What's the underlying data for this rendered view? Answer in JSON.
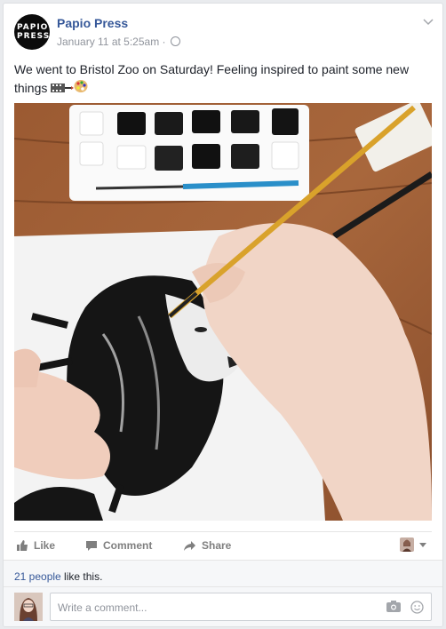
{
  "post": {
    "page_name": "Papio Press",
    "avatar_text": "PAPIO\nPRESS",
    "timestamp": "January 11 at 5:25am",
    "separator": "·",
    "text": "We went to Bristol Zoo on Saturday! Feeling inspired to paint some new things",
    "photo_icon": "photo-of-painting",
    "emoji_names": [
      "film-strip-emoji",
      "paintbrush-emoji",
      "palette-emoji"
    ]
  },
  "actions": {
    "like_label": "Like",
    "comment_label": "Comment",
    "share_label": "Share"
  },
  "likes": {
    "count_text": "21 people",
    "suffix": " like this."
  },
  "comment": {
    "placeholder": "Write a comment..."
  },
  "colors": {
    "link": "#365899",
    "text": "#1d2129",
    "muted": "#90949c",
    "background": "#e9ebee"
  }
}
